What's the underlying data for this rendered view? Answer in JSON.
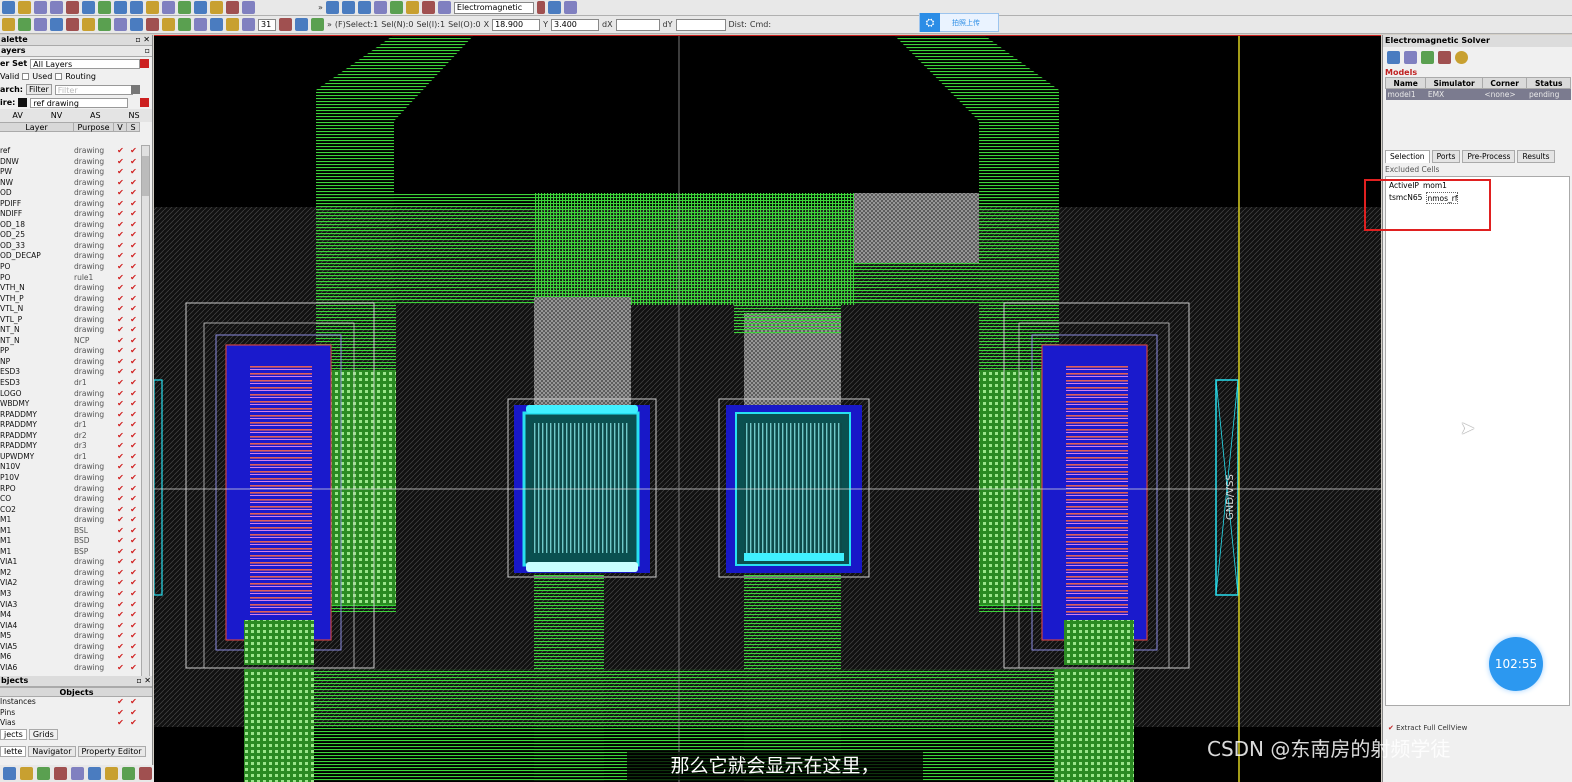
{
  "toolbar": {
    "mode_select": "Electromagnetic",
    "grid_value": "31",
    "status_select": "(F)Select:1",
    "sel_n": "Sel(N):0",
    "sel_i": "Sel(I):1",
    "sel_o": "Sel(O):0",
    "x_label": "X",
    "x_value": "18.900",
    "y_label": "Y",
    "y_value": "3.400",
    "dx_label": "dX",
    "dy_label": "dY",
    "dist_label": "Dist:",
    "cmd_label": "Cmd:",
    "upload_text": "拍照上传"
  },
  "palette": {
    "title": "alette",
    "layers_header": "ayers",
    "filter_set_label": "er Set",
    "filter_set_value": "All Layers",
    "valid_label": "Valid",
    "used_label": "Used",
    "routing_label": "Routing",
    "search_label": "arch:",
    "filter_button": "Filter",
    "search_placeholder": "Filter",
    "wire_label": "ire:",
    "wire_value": "ref drawing",
    "visibility": [
      "AV",
      "NV",
      "AS",
      "NS"
    ],
    "columns": [
      "Layer",
      "Purpose",
      "V",
      "S"
    ],
    "layers": [
      {
        "name": "ref",
        "purpose": "drawing"
      },
      {
        "name": "DNW",
        "purpose": "drawing"
      },
      {
        "name": "PW",
        "purpose": "drawing"
      },
      {
        "name": "NW",
        "purpose": "drawing"
      },
      {
        "name": "OD",
        "purpose": "drawing"
      },
      {
        "name": "PDIFF",
        "purpose": "drawing"
      },
      {
        "name": "NDIFF",
        "purpose": "drawing"
      },
      {
        "name": "OD_18",
        "purpose": "drawing"
      },
      {
        "name": "OD_25",
        "purpose": "drawing"
      },
      {
        "name": "OD_33",
        "purpose": "drawing"
      },
      {
        "name": "OD_DECAP",
        "purpose": "drawing"
      },
      {
        "name": "PO",
        "purpose": "drawing"
      },
      {
        "name": "PO",
        "purpose": "rule1"
      },
      {
        "name": "VTH_N",
        "purpose": "drawing"
      },
      {
        "name": "VTH_P",
        "purpose": "drawing"
      },
      {
        "name": "VTL_N",
        "purpose": "drawing"
      },
      {
        "name": "VTL_P",
        "purpose": "drawing"
      },
      {
        "name": "NT_N",
        "purpose": "drawing"
      },
      {
        "name": "NT_N",
        "purpose": "NCP"
      },
      {
        "name": "PP",
        "purpose": "drawing"
      },
      {
        "name": "NP",
        "purpose": "drawing"
      },
      {
        "name": "ESD3",
        "purpose": "drawing"
      },
      {
        "name": "ESD3",
        "purpose": "dr1"
      },
      {
        "name": "LOGO",
        "purpose": "drawing"
      },
      {
        "name": "WBDMY",
        "purpose": "drawing"
      },
      {
        "name": "RPADDMY",
        "purpose": "drawing"
      },
      {
        "name": "RPADDMY",
        "purpose": "dr1"
      },
      {
        "name": "RPADDMY",
        "purpose": "dr2"
      },
      {
        "name": "RPADDMY",
        "purpose": "dr3"
      },
      {
        "name": "UPWDMY",
        "purpose": "dr1"
      },
      {
        "name": "N10V",
        "purpose": "drawing"
      },
      {
        "name": "P10V",
        "purpose": "drawing"
      },
      {
        "name": "RPO",
        "purpose": "drawing"
      },
      {
        "name": "CO",
        "purpose": "drawing"
      },
      {
        "name": "CO2",
        "purpose": "drawing"
      },
      {
        "name": "M1",
        "purpose": "drawing"
      },
      {
        "name": "M1",
        "purpose": "BSL"
      },
      {
        "name": "M1",
        "purpose": "BSD"
      },
      {
        "name": "M1",
        "purpose": "BSP"
      },
      {
        "name": "VIA1",
        "purpose": "drawing"
      },
      {
        "name": "M2",
        "purpose": "drawing"
      },
      {
        "name": "VIA2",
        "purpose": "drawing"
      },
      {
        "name": "M3",
        "purpose": "drawing"
      },
      {
        "name": "VIA3",
        "purpose": "drawing"
      },
      {
        "name": "M4",
        "purpose": "drawing"
      },
      {
        "name": "VIA4",
        "purpose": "drawing"
      },
      {
        "name": "M5",
        "purpose": "drawing"
      },
      {
        "name": "VIA5",
        "purpose": "drawing"
      },
      {
        "name": "M6",
        "purpose": "drawing"
      },
      {
        "name": "VIA6",
        "purpose": "drawing"
      }
    ],
    "objects_title": "bjects",
    "objects_header": "Objects",
    "objects": [
      "Instances",
      "Pins",
      "Vias"
    ],
    "obj_tabs": [
      "jects",
      "Grids"
    ],
    "bottom_tabs": [
      "lette",
      "Navigator",
      "Property Editor"
    ]
  },
  "solver": {
    "title": "Electromagnetic Solver",
    "models_label": "Models",
    "model_columns": [
      "Name",
      "Simulator",
      "Corner",
      "Status"
    ],
    "models": [
      {
        "name": "model1",
        "simulator": "EMX",
        "corner": "<none>",
        "status": "pending"
      }
    ],
    "tabs": [
      "Selection",
      "Ports",
      "Pre-Process",
      "Results"
    ],
    "excluded_label": "Excluded Cells",
    "excluded": [
      {
        "lib": "ActiveIP",
        "cell": "mom1"
      },
      {
        "lib": "tsmcN65",
        "cell": "nmos_rf"
      }
    ],
    "extract_label": "Extract Full CellView"
  },
  "layout": {
    "pin_label": "GND/VSS"
  },
  "overlay": {
    "timer": "102:55",
    "subtitle": "那么它就会显示在这里，",
    "watermark": "CSDN @东南房的射频学徒"
  },
  "colors": {
    "green": "#3dd43a",
    "cyan": "#28e0f0",
    "blue": "#1818c8",
    "highlight": "#e02020"
  }
}
